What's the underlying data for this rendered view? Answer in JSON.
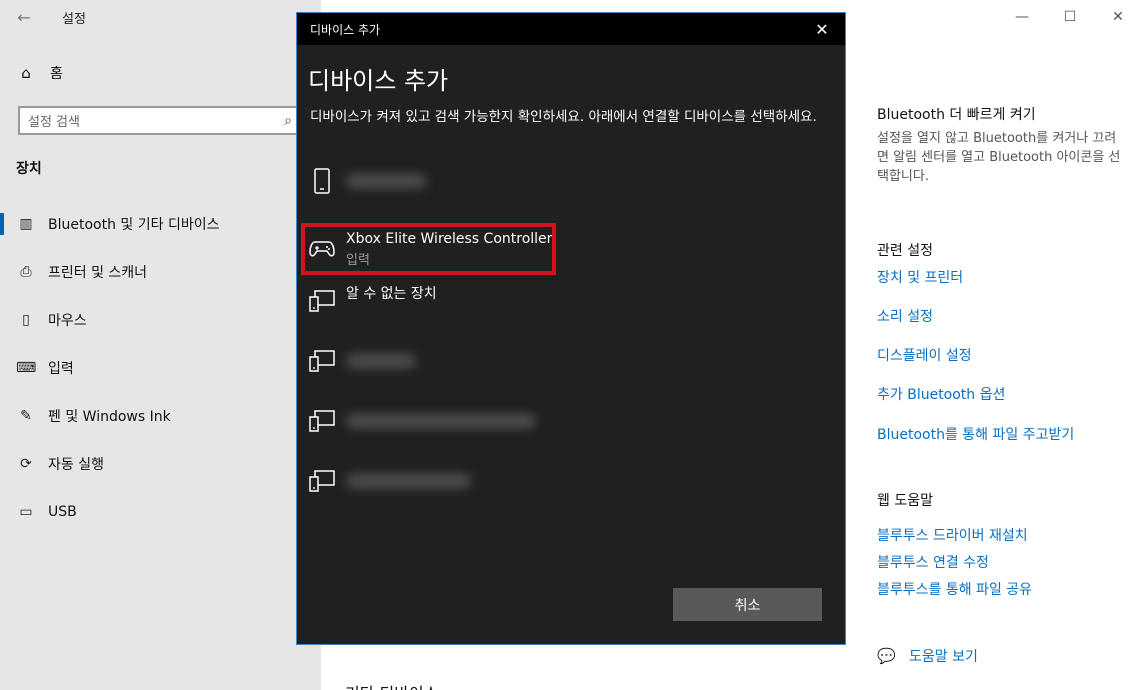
{
  "window": {
    "title": "설정",
    "back_icon": "back-arrow-icon",
    "controls": [
      "minimize-icon",
      "maximize-icon",
      "close-icon"
    ]
  },
  "sidebar": {
    "home_label": "홈",
    "search_placeholder": "설정 검색",
    "section_title": "장치",
    "items": [
      {
        "label": "Bluetooth 및 기타 디바이스",
        "icon": "bluetooth-devices-icon",
        "active": true
      },
      {
        "label": "프린터 및 스캐너",
        "icon": "printer-icon"
      },
      {
        "label": "마우스",
        "icon": "mouse-icon"
      },
      {
        "label": "입력",
        "icon": "keyboard-icon"
      },
      {
        "label": "펜 및 Windows Ink",
        "icon": "pen-icon"
      },
      {
        "label": "자동 실행",
        "icon": "autoplay-icon"
      },
      {
        "label": "USB",
        "icon": "usb-icon"
      }
    ]
  },
  "right_panel": {
    "quick_title": "Bluetooth 더 빠르게 켜기",
    "quick_text": "설정을 열지 않고 Bluetooth를 켜거나 끄려면 알림 센터를 열고 Bluetooth 아이콘을 선택합니다.",
    "related_title": "관련 설정",
    "related_links": [
      "장치 및 프린터",
      "소리 설정",
      "디스플레이 설정",
      "추가 Bluetooth 옵션",
      "Bluetooth를 통해 파일 주고받기"
    ],
    "web_help_title": "웹 도움말",
    "web_help_links": [
      "블루투스 드라이버 재설치",
      "블루투스 연결 수정",
      "블루투스를 통해 파일 공유"
    ],
    "get_help": "도움말 보기",
    "bottom_cut_text": "기타 디바이스"
  },
  "dialog": {
    "titlebar": "디바이스 추가",
    "heading": "디바이스 추가",
    "description": "디바이스가 켜져 있고 검색 가능한지 확인하세요. 아래에서 연결할 디바이스를 선택하세요.",
    "devices": [
      {
        "icon": "phone-icon",
        "name": "",
        "blurred": true
      },
      {
        "icon": "gamepad-icon",
        "name": "Xbox Elite Wireless Controller",
        "subtitle": "입력",
        "highlighted": true
      },
      {
        "icon": "unknown-device-icon",
        "name": "알 수 없는 장치"
      },
      {
        "icon": "unknown-device-icon",
        "name": "",
        "blurred": true
      },
      {
        "icon": "unknown-device-icon",
        "name": "",
        "blurred": true
      },
      {
        "icon": "unknown-device-icon",
        "name": "",
        "blurred": true
      }
    ],
    "cancel_label": "취소",
    "highlight_color": "#d4121b"
  }
}
